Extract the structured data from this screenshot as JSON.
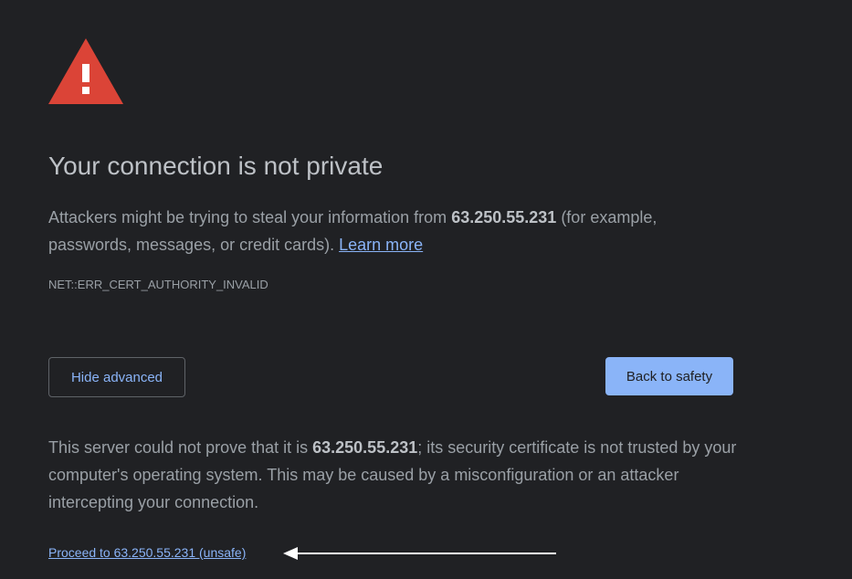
{
  "page": {
    "title": "Your connection is not private",
    "intro": {
      "before_host": "Attackers might be trying to steal your information from ",
      "host": "63.250.55.231",
      "after_host": " (for example, passwords, messages, or credit cards). ",
      "learn_more": "Learn more"
    },
    "error_code": "NET::ERR_CERT_AUTHORITY_INVALID",
    "buttons": {
      "hide_advanced": "Hide advanced",
      "back_to_safety": "Back to safety"
    },
    "explanation": {
      "before_host": "This server could not prove that it is ",
      "host": "63.250.55.231",
      "after_host": "; its security certificate is not trusted by your computer's operating system. This may be caused by a misconfiguration or an attacker intercepting your connection."
    },
    "proceed_link": "Proceed to 63.250.55.231 (unsafe)"
  },
  "colors": {
    "background": "#202124",
    "title": "#bdc1c6",
    "text": "#9aa0a6",
    "link": "#8ab4f8",
    "warning_red": "#db4437",
    "primary_button": "#8ab4f8"
  },
  "icons": {
    "warning": "warning-triangle-icon",
    "arrow": "arrow-left-icon"
  }
}
